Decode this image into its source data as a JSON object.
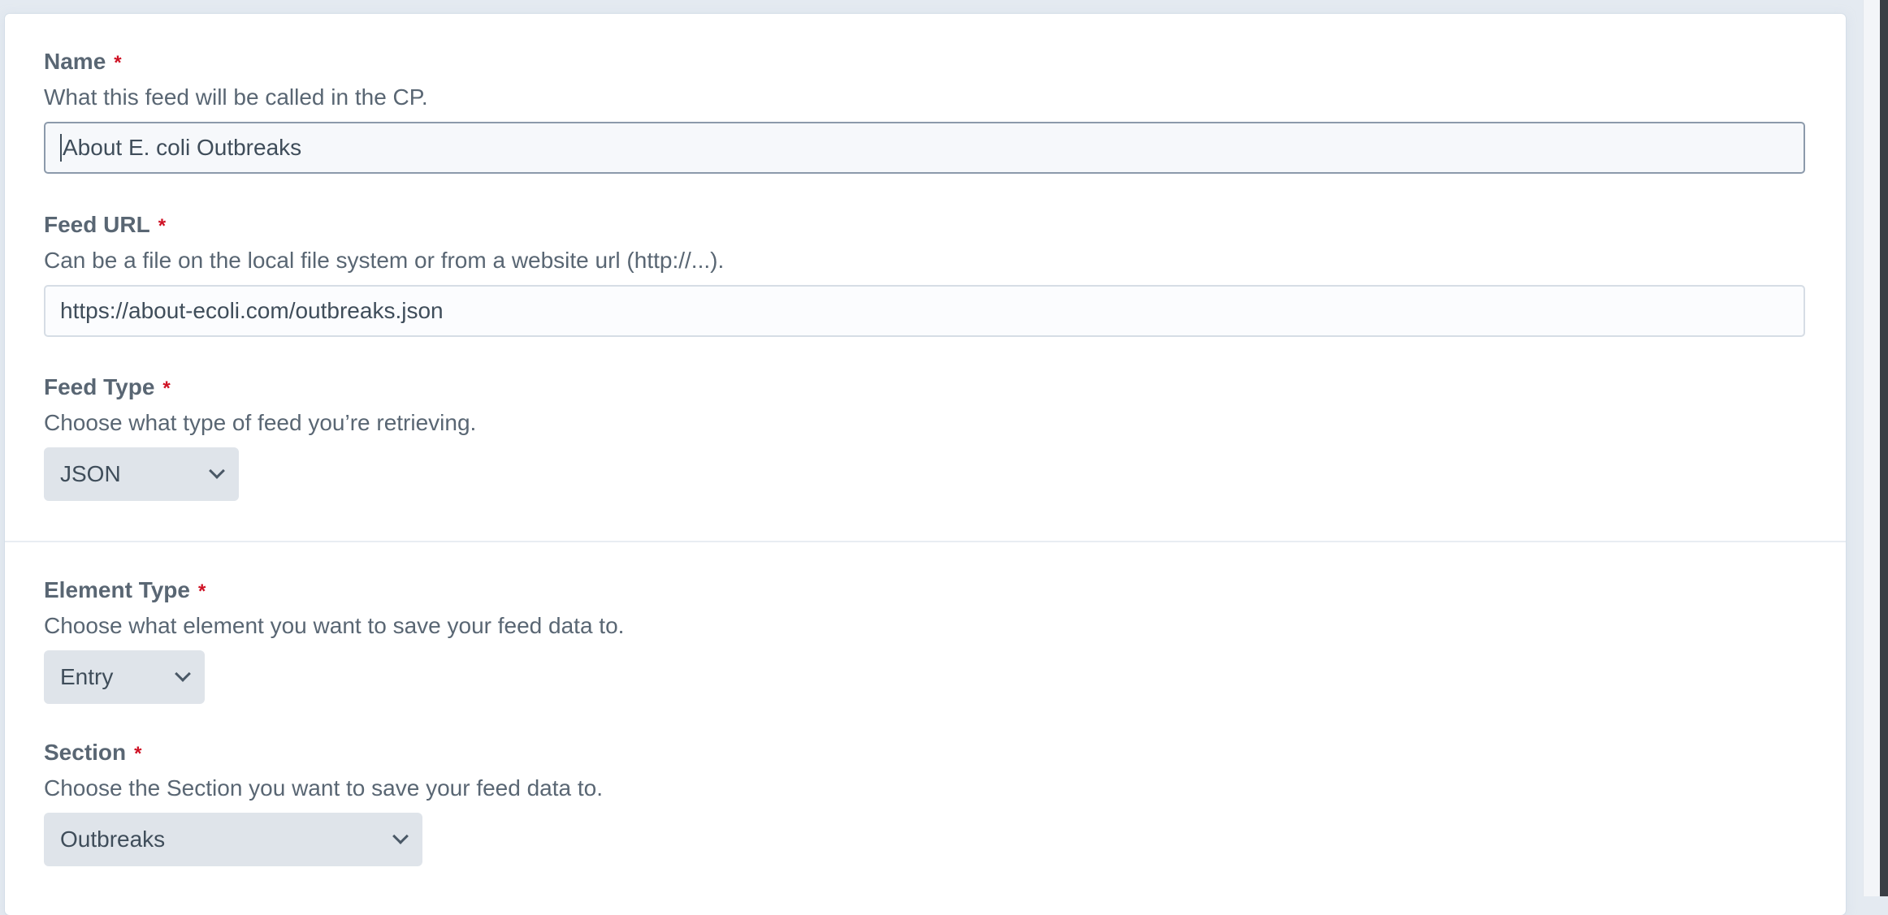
{
  "fields": {
    "name": {
      "label": "Name",
      "required_mark": "*",
      "instructions": "What this feed will be called in the CP.",
      "value": "About E. coli Outbreaks"
    },
    "feed_url": {
      "label": "Feed URL",
      "required_mark": "*",
      "instructions": "Can be a file on the local file system or from a website url (http://...).",
      "value": "https://about-ecoli.com/outbreaks.json"
    },
    "feed_type": {
      "label": "Feed Type",
      "required_mark": "*",
      "instructions": "Choose what type of feed you’re retrieving.",
      "selected": "JSON"
    },
    "element_type": {
      "label": "Element Type",
      "required_mark": "*",
      "instructions": "Choose what element you want to save your feed data to.",
      "selected": "Entry"
    },
    "section": {
      "label": "Section",
      "required_mark": "*",
      "instructions": "Choose the Section you want to save your feed data to.",
      "selected": "Outbreaks"
    }
  },
  "icons": {
    "select_arrow": "chevron-down-icon",
    "required": "asterisk"
  },
  "colors": {
    "required": "#cf1124",
    "label": "#596673",
    "select_bg": "#dfe4ea",
    "page_bg": "#e4eaf1"
  }
}
